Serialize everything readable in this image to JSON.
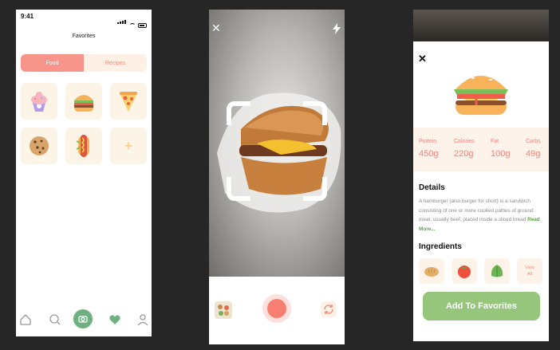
{
  "screen1": {
    "status": {
      "time": "9:41"
    },
    "title": "Favorites",
    "tabs": [
      {
        "label": "Food",
        "active": true
      },
      {
        "label": "Recipes",
        "active": false
      }
    ],
    "items": [
      {
        "name": "cupcake-icon"
      },
      {
        "name": "burger-icon"
      },
      {
        "name": "pizza-icon"
      },
      {
        "name": "cookie-icon"
      },
      {
        "name": "hotdog-icon"
      },
      {
        "name": "add-icon",
        "label": "+"
      }
    ],
    "nav": [
      "home-icon",
      "search-icon",
      "camera-icon",
      "heart-icon",
      "profile-icon"
    ]
  },
  "screen2": {
    "top_left_icon": "close-icon",
    "top_right_icon": "flash-icon",
    "top_left_glyph": "✕",
    "bottom": [
      "gallery-thumbnail",
      "shutter-button",
      "flip-camera-icon"
    ]
  },
  "screen3": {
    "close_glyph": "✕",
    "nutrition": [
      {
        "label": "Protein",
        "value": "450g"
      },
      {
        "label": "Calories",
        "value": "220g"
      },
      {
        "label": "Fat",
        "value": "100g"
      },
      {
        "label": "Carbs",
        "value": "49g"
      }
    ],
    "details_heading": "Details",
    "description": "A hamburger (also burger for short) is a sandwich consisting of one or more cooked patties of ground meat, usually beef, placed inside a sliced bread",
    "read_more": "Read More...",
    "ingredients_heading": "Ingredients",
    "ingredients": [
      "bread-icon",
      "tomato-icon",
      "lettuce-icon"
    ],
    "view_all": {
      "line1": "View",
      "line2": "All"
    },
    "add_button": "Add To Favorites"
  },
  "colors": {
    "accent_coral": "#f8958a",
    "cream": "#fdf4e8",
    "green": "#95c67c"
  }
}
